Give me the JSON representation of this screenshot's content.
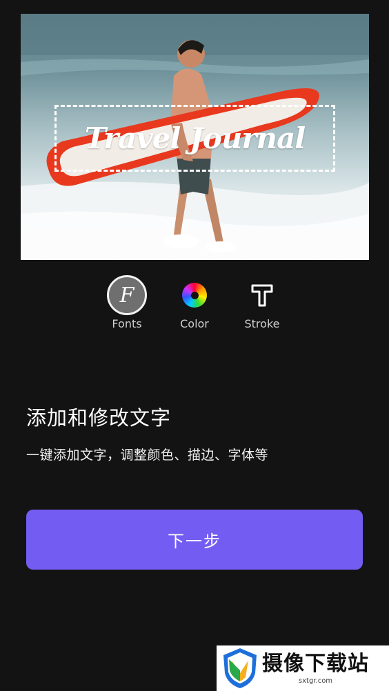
{
  "preview": {
    "overlay_text": "Travel Journal"
  },
  "tools": [
    {
      "label": "Fonts",
      "icon": "fonts-icon",
      "glyph": "F"
    },
    {
      "label": "Color",
      "icon": "color-wheel-icon"
    },
    {
      "label": "Stroke",
      "icon": "stroke-icon"
    }
  ],
  "feature": {
    "title": "添加和修改文字",
    "description": "一键添加文字，调整颜色、描边、字体等"
  },
  "next_button": {
    "label": "下一步",
    "color": "#735cf2"
  },
  "watermark": {
    "name": "摄像下载站",
    "url": "sxtgr.com"
  }
}
